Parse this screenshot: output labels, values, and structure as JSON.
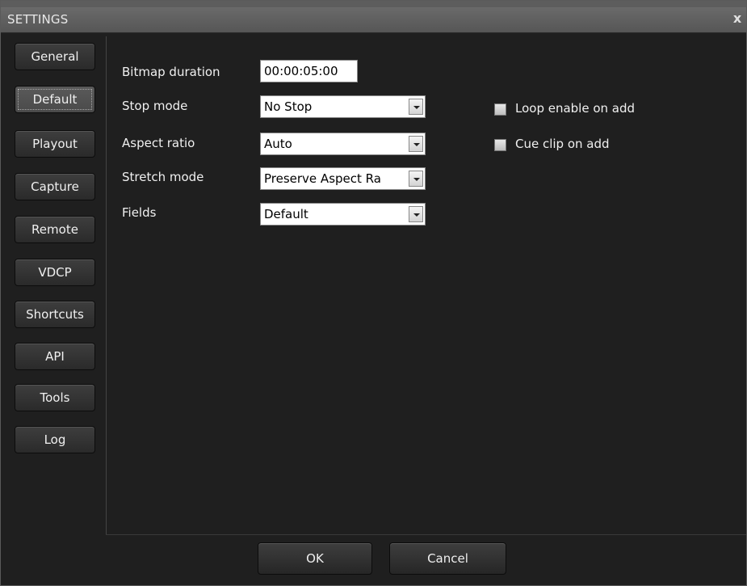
{
  "window": {
    "title": "SETTINGS",
    "close_symbol": "x"
  },
  "sidebar": {
    "items": [
      {
        "label": "General"
      },
      {
        "label": "Default",
        "active": true
      },
      {
        "label": "Playout"
      },
      {
        "label": "Capture"
      },
      {
        "label": "Remote"
      },
      {
        "label": "VDCP"
      },
      {
        "label": "Shortcuts"
      },
      {
        "label": "API"
      },
      {
        "label": "Tools"
      },
      {
        "label": "Log"
      }
    ]
  },
  "form": {
    "bitmap_duration": {
      "label": "Bitmap duration",
      "value": "00:00:05:00"
    },
    "stop_mode": {
      "label": "Stop mode",
      "value": "No Stop"
    },
    "aspect_ratio": {
      "label": "Aspect ratio",
      "value": "Auto"
    },
    "stretch_mode": {
      "label": "Stretch mode",
      "value": "Preserve Aspect Ra"
    },
    "fields": {
      "label": "Fields",
      "value": "Default"
    }
  },
  "options": {
    "loop_enable": {
      "label": "Loop enable on add",
      "checked": false
    },
    "cue_clip": {
      "label": "Cue clip on add",
      "checked": false
    }
  },
  "footer": {
    "ok_label": "OK",
    "cancel_label": "Cancel"
  }
}
